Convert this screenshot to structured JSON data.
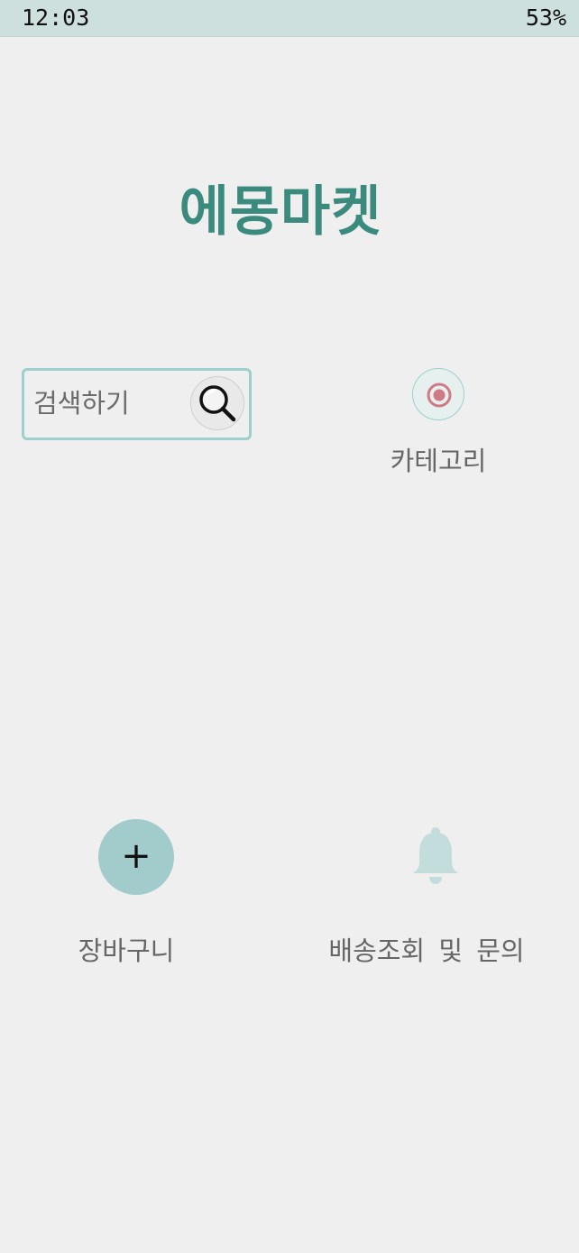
{
  "status_bar": {
    "time": "12:03",
    "battery": "53%"
  },
  "header": {
    "title": "에몽마켓"
  },
  "search": {
    "placeholder": "검색하기",
    "value": "",
    "icon": "magnifier-icon"
  },
  "category": {
    "label": "카테고리",
    "icon": "radio-target-icon"
  },
  "cart": {
    "label": "장바구니",
    "symbol": "+",
    "icon": "plus-icon"
  },
  "delivery": {
    "label": "배송조회 및 문의",
    "icon": "bell-icon"
  },
  "colors": {
    "background": "#efefef",
    "status_bar": "#cde0de",
    "accent": "#3a8a7e",
    "teal_light": "#a2cbcb",
    "border": "#9fcfcc",
    "bell": "#c3dcdc",
    "target": "#d07a85"
  }
}
